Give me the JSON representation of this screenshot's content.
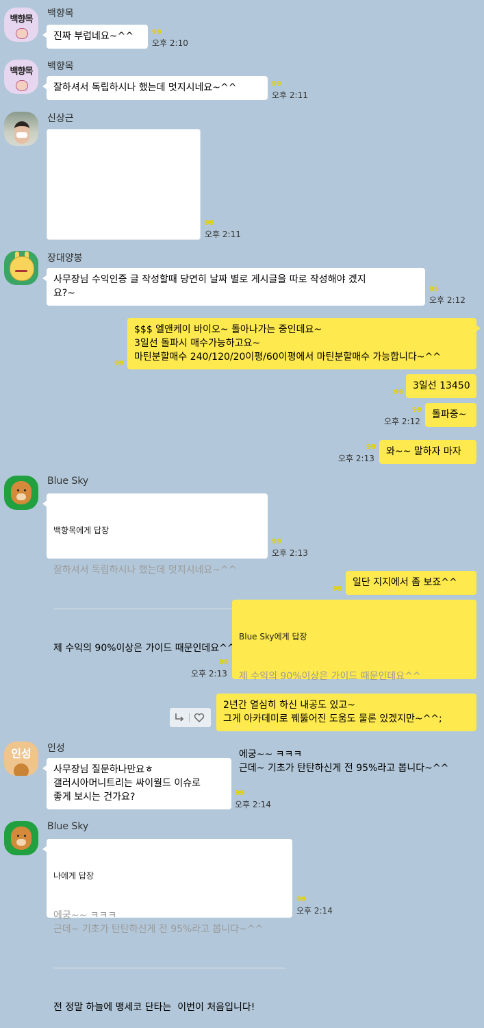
{
  "messages": {
    "m1": {
      "sender": "백향목",
      "text": "진짜 부럽네요~^^",
      "unread": "99",
      "time": "오후 2:10"
    },
    "m2": {
      "sender": "백향목",
      "text": "잘하셔서 독립하시나 했는데 멋지시네요~^^",
      "unread": "99",
      "time": "오후 2:11"
    },
    "m3": {
      "sender": "신상근",
      "unread": "99",
      "time": "오후 2:11"
    },
    "m4": {
      "sender": "장대양봉",
      "text": "사무장님 수익인증 글 작성할때 당연히 날짜 별로 게시글을 따로 작성해야 겠지\n요?~",
      "unread": "99",
      "time": "오후 2:12"
    },
    "m5": {
      "text": "$$$ 엘앤케이 바이오~ 돌아나가는 중인데요~\n3일선 돌파시 매수가능하고요~\n마틴분할매수 240/120/20이평/60이평에서 마틴분할매수 가능합니다~^^",
      "unread": "99"
    },
    "m6": {
      "text": "3일선 13450",
      "unread": "99"
    },
    "m7": {
      "text": "돌파중~",
      "unread": "99",
      "time": "오후 2:12"
    },
    "m8": {
      "text": "와~~ 말하자 마자",
      "unread": "99",
      "time": "오후 2:13"
    },
    "m9": {
      "sender": "Blue Sky",
      "reply_to": "백향목에게 답장",
      "quote": "잘하셔서 독립하시나 했는데 멋지시네요~^^",
      "text": "제 수익의 90%이상은 가이드 때문인데요^^",
      "unread": "99",
      "time": "오후 2:13"
    },
    "m10": {
      "text": "일단 지지에서 좀 보죠^^",
      "unread": "99"
    },
    "m11": {
      "reply_to": "Blue Sky에게 답장",
      "quote": "제 수익의 90%이상은 가이드 때문인데요^^",
      "text": "에궁~~ ㅋㅋㅋ\n근데~ 기초가 탄탄하신게 전 95%라고 봅니다~^^",
      "unread": "99",
      "time": "오후 2:13"
    },
    "m12": {
      "text": "2년간 열심히 하신 내공도 있고~\n그게 아카데미로 꿰뚫어진 도움도 물론 있겠지만~^^;"
    },
    "m13": {
      "sender": "인성",
      "text": "사무장님 질문하나만요ㅎ\n갤러시아머니트리는 싸이월드 이슈로\n좋게 보시는 건가요?",
      "unread": "99",
      "time": "오후 2:14"
    },
    "m14": {
      "sender": "Blue Sky",
      "reply_to": "나에게 답장",
      "quote": "에궁~~ ㅋㅋㅋ\n근데~ 기초가 탄탄하신게 전 95%라고 봅니다~^^",
      "text": "전 정말 하늘에 맹세코 단타는  이번이 처음입니다!",
      "unread": "99",
      "time": "오후 2:14"
    }
  },
  "avatars": {
    "baek_label": "백향목",
    "insung_label": "인성"
  },
  "icons": {
    "reply": "reply-icon",
    "heart": "heart-icon"
  },
  "colors": {
    "background": "#b2c7d9",
    "my_bubble": "#fee94e",
    "their_bubble": "#ffffff",
    "unread": "#e6d000"
  }
}
